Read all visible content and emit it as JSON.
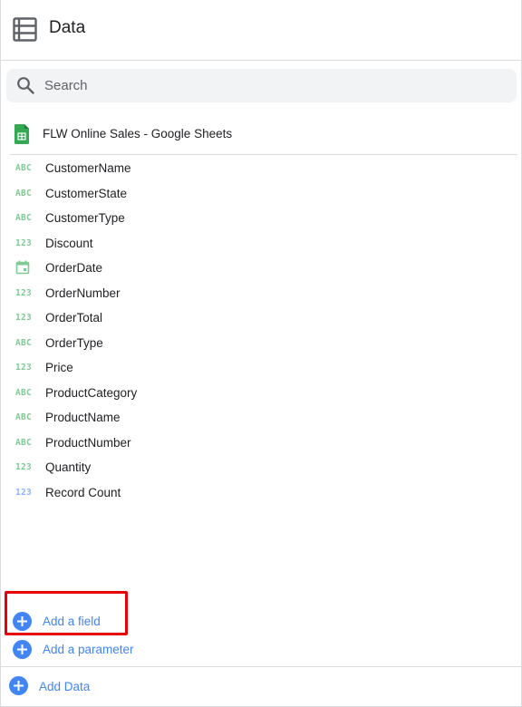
{
  "header": {
    "title": "Data",
    "icon": "data-table-icon"
  },
  "search": {
    "placeholder": "Search",
    "value": "",
    "icon": "search-icon"
  },
  "source": {
    "name": "FLW Online Sales - Google Sheets",
    "icon": "google-sheets-icon"
  },
  "fields": [
    {
      "label": "CustomerName",
      "type": "ABC",
      "kind": "dimension"
    },
    {
      "label": "CustomerState",
      "type": "ABC",
      "kind": "dimension"
    },
    {
      "label": "CustomerType",
      "type": "ABC",
      "kind": "dimension"
    },
    {
      "label": "Discount",
      "type": "123",
      "kind": "dimension"
    },
    {
      "label": "OrderDate",
      "type": "calendar",
      "kind": "dimension"
    },
    {
      "label": "OrderNumber",
      "type": "123",
      "kind": "dimension"
    },
    {
      "label": "OrderTotal",
      "type": "123",
      "kind": "dimension"
    },
    {
      "label": "OrderType",
      "type": "ABC",
      "kind": "dimension"
    },
    {
      "label": "Price",
      "type": "123",
      "kind": "dimension"
    },
    {
      "label": "ProductCategory",
      "type": "ABC",
      "kind": "dimension"
    },
    {
      "label": "ProductName",
      "type": "ABC",
      "kind": "dimension"
    },
    {
      "label": "ProductNumber",
      "type": "ABC",
      "kind": "dimension"
    },
    {
      "label": "Quantity",
      "type": "123",
      "kind": "dimension"
    },
    {
      "label": "Record Count",
      "type": "123",
      "kind": "metric"
    }
  ],
  "actions": {
    "add_field": "Add a field",
    "add_parameter": "Add a parameter"
  },
  "footer": {
    "add_data": "Add Data"
  },
  "colors": {
    "dimension": "#81c995",
    "metric": "#8ab4f8",
    "link": "#4285f4",
    "highlight": "#e8000b"
  }
}
